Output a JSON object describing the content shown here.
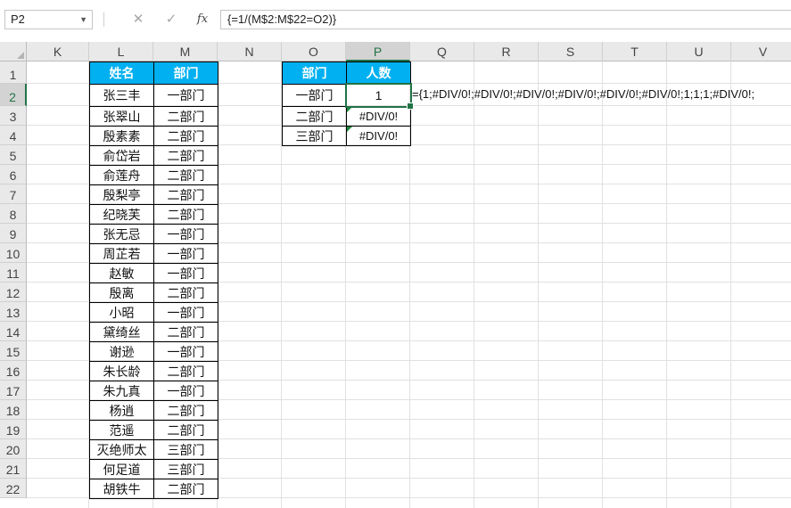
{
  "formula_bar": {
    "name_box": "P2",
    "cancel_icon": "✕",
    "enter_icon": "✓",
    "fx_label": "fx",
    "formula": "{=1/(M$2:M$22=O2)}"
  },
  "columns": [
    "K",
    "L",
    "M",
    "N",
    "O",
    "P",
    "Q",
    "R",
    "S",
    "T",
    "U",
    "V"
  ],
  "selected_column": "P",
  "rows": [
    "1",
    "2",
    "3",
    "4",
    "5",
    "6",
    "7",
    "8",
    "9",
    "10",
    "11",
    "12",
    "13",
    "14",
    "15",
    "16",
    "17",
    "18",
    "19",
    "20",
    "21",
    "22"
  ],
  "selected_row": "2",
  "left_table": {
    "headers": [
      "姓名",
      "部门"
    ],
    "rows": [
      [
        "张三丰",
        "一部门"
      ],
      [
        "张翠山",
        "二部门"
      ],
      [
        "殷素素",
        "二部门"
      ],
      [
        "俞岱岩",
        "二部门"
      ],
      [
        "俞莲舟",
        "二部门"
      ],
      [
        "殷梨亭",
        "二部门"
      ],
      [
        "纪晓芙",
        "二部门"
      ],
      [
        "张无忌",
        "一部门"
      ],
      [
        "周芷若",
        "一部门"
      ],
      [
        "赵敏",
        "一部门"
      ],
      [
        "殷离",
        "二部门"
      ],
      [
        "小昭",
        "一部门"
      ],
      [
        "黛绮丝",
        "二部门"
      ],
      [
        "谢逊",
        "一部门"
      ],
      [
        "朱长龄",
        "二部门"
      ],
      [
        "朱九真",
        "一部门"
      ],
      [
        "杨逍",
        "二部门"
      ],
      [
        "范遥",
        "二部门"
      ],
      [
        "灭绝师太",
        "三部门"
      ],
      [
        "何足道",
        "三部门"
      ],
      [
        "胡铁牛",
        "二部门"
      ]
    ]
  },
  "right_table": {
    "headers": [
      "部门",
      "人数"
    ],
    "rows": [
      [
        "一部门",
        "1"
      ],
      [
        "二部门",
        "#DIV/0!"
      ],
      [
        "三部门",
        "#DIV/0!"
      ]
    ]
  },
  "overflow_text": "={1;#DIV/0!;#DIV/0!;#DIV/0!;#DIV/0!;#DIV/0!;#DIV/0!;1;1;1;#DIV/0!;",
  "colors": {
    "header_fill": "#00b0f0",
    "selection": "#217346",
    "error_marker": "#1e8a3c"
  }
}
